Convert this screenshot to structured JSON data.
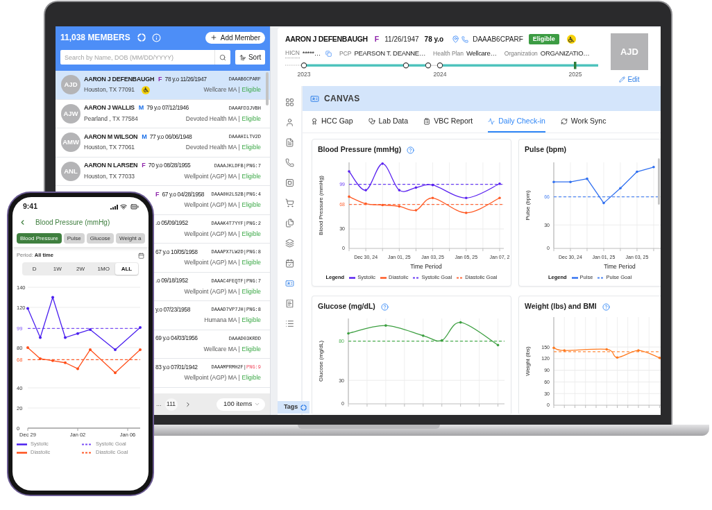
{
  "laptop": {
    "members_panel": {
      "title": "11,038 MEMBERS",
      "add_button": "Add Member",
      "search": {
        "placeholder": "Search by Name, DOB (MM/DD/YYYY)"
      },
      "sort_button": "Sort",
      "members": [
        {
          "initials": "AJD",
          "name": "AARON J DEFENBAUGH",
          "sex": {
            "text": "F",
            "color": "#8e24aa"
          },
          "age_dob": "78 y.o 11/26/1947",
          "member_id": "DAAAB6CPARF",
          "location": "Houston, TX 77091",
          "wheelchair": true,
          "plan": "Wellcare MA |",
          "status": "Eligible",
          "eligible": true,
          "selected": true
        },
        {
          "initials": "AJW",
          "name": "AARON J WALLIS",
          "sex": {
            "text": "M",
            "color": "#1a6fe8"
          },
          "age_dob": "79 y.o 07/12/1946",
          "member_id": "DAAAFD3JVBH",
          "location": "Pearland , TX 77584",
          "wheelchair": false,
          "plan": "Devoted Health MA |",
          "status": "Eligible",
          "eligible": true,
          "selected": false
        },
        {
          "initials": "AMW",
          "name": "AARON M WILSON",
          "sex": {
            "text": "M",
            "color": "#1a6fe8"
          },
          "age_dob": "77 y.o 06/06/1948",
          "member_id": "DAAAHILTV2D",
          "location": "Houston, TX 77061",
          "wheelchair": false,
          "plan": "Devoted Health MA |",
          "status": "Eligible",
          "eligible": true,
          "selected": false
        },
        {
          "initials": "ANL",
          "name": "AARON N LARSEN",
          "sex": {
            "text": "F",
            "color": "#8e24aa"
          },
          "age_dob": "70 y.o 08/28/1955",
          "member_id": "DAAAJKLDFB|",
          "png": {
            "text": "PNG:7",
            "alert": false
          },
          "location": "Houston, TX 77033",
          "wheelchair": false,
          "plan": "Wellpoint (AGP) MA |",
          "status": "Eligible",
          "eligible": true,
          "selected": false
        },
        {
          "sex": {
            "text": "F",
            "color": "#8e24aa"
          },
          "age_dob": "67 y.o 04/28/1958",
          "member_id": "DAAA0H2LS2B|",
          "png": {
            "text": "PNG:4",
            "alert": false
          },
          "wheelchair": false,
          "plan": "Wellpoint (AGP) MA |",
          "status": "Eligible",
          "eligible": true,
          "selected": false
        },
        {
          "age_dob": ".o 05/09/1952",
          "member_id": "DAAAK4T7YYF|",
          "png": {
            "text": "PNG:2",
            "alert": false
          },
          "wheelchair": false,
          "plan": "Wellpoint (AGP) MA |",
          "status": "Eligible",
          "eligible": true,
          "selected": false
        },
        {
          "age_dob": "67 y.o 10/05/1958",
          "member_id": "DAAAPX7LW2D|",
          "png": {
            "text": "PNG:8",
            "alert": false
          },
          "wheelchair": false,
          "plan": "Wellpoint (AGP) MA |",
          "status": "Eligible",
          "eligible": true,
          "selected": false
        },
        {
          "age_dob": ".o 09/18/1952",
          "member_id": "DAAAC4FEQTF|",
          "png": {
            "text": "PNG:7",
            "alert": false
          },
          "wheelchair": false,
          "plan": "Wellpoint (AGP) MA |",
          "status": "Eligible",
          "eligible": true,
          "selected": false
        },
        {
          "age_dob": "y.o 07/23/1958",
          "member_id": "DAAAD7VP7JH|",
          "png": {
            "text": "PNG:8",
            "alert": false
          },
          "wheelchair": false,
          "plan": "Humana MA |",
          "status": "Eligible",
          "eligible": true,
          "selected": false
        },
        {
          "age_dob": "69 y.o 04/03/1956",
          "member_id": "DAAAD03KRDD",
          "wheelchair": false,
          "plan": "Wellcare MA |",
          "status": "Eligible",
          "eligible": true,
          "selected": false
        },
        {
          "age_dob": "83 y.o 07/01/1942",
          "member_id": "DAAAMPRMH2F|",
          "png": {
            "text": "PNG:9",
            "alert": true
          },
          "wheelchair": false,
          "plan": "Wellpoint (AGP) MA |",
          "status": "Eligible",
          "eligible": true,
          "selected": false
        }
      ],
      "pagination": {
        "ellipsis": "...",
        "page": "111",
        "page_size": "100 items"
      }
    },
    "patient": {
      "name": "AARON J DEFENBAUGH",
      "sex": {
        "text": "F",
        "color": "#8e24aa"
      },
      "dob": "11/26/1947",
      "age": "78 y.o",
      "member_id": "DAAAB6CPARF",
      "badge": "Eligible",
      "wheelchair": true,
      "fields": [
        {
          "label": "HICN",
          "value": "*****…",
          "copyable": true
        },
        {
          "label": "PCP",
          "value": "PEARSON T. DEANNE…",
          "copyable": false
        },
        {
          "label": "Health Plan",
          "value": "Wellcare…",
          "copyable": false
        },
        {
          "label": "Organization",
          "value": "ORGANIZATIO…",
          "copyable": false
        }
      ],
      "timeline_years": [
        "2023",
        "2024",
        "2025"
      ],
      "initials": "AJD",
      "edit_link": "Edit"
    },
    "sidebar": {
      "items": [
        {
          "selected": false
        },
        {
          "selected": false
        },
        {
          "selected": false
        },
        {
          "selected": false
        },
        {
          "selected": false
        },
        {
          "selected": false
        },
        {
          "selected": false
        },
        {
          "selected": false
        },
        {
          "selected": false
        },
        {
          "selected": true
        },
        {
          "selected": false
        },
        {
          "selected": false
        }
      ],
      "tags_label": "Tags"
    },
    "canvas": {
      "title": "CANVAS",
      "tabs": [
        {
          "label": "HCC Gap",
          "selected": false
        },
        {
          "label": "Lab Data",
          "selected": false
        },
        {
          "label": "VBC Report",
          "selected": false
        },
        {
          "label": "Daily Check-in",
          "selected": true
        },
        {
          "label": "Work Sync",
          "selected": false
        }
      ],
      "cards": [
        {
          "help": true,
          "legend_title": "Legend",
          "chart_data": {
            "type": "line",
            "title": "Blood Pressure (mmHg)",
            "xlabel": "Time Period",
            "ylabel": "Blood Pressure (mmHg)",
            "categories": [
              null,
              "Dec 30, 24",
              null,
              "Jan 01, 25",
              null,
              "Jan 03, 25",
              null,
              "Jan 05, 25",
              null,
              "Jan 07, 2"
            ],
            "ylim": [
              0,
              133
            ],
            "yticks": [
              0,
              30,
              68,
              99
            ],
            "grid": "both",
            "legend": "bottom",
            "series": [
              {
                "name": "Systolic",
                "color": "#5a22f0",
                "values": [
                  119,
                  90,
                  131,
                  90,
                  94,
                  98,
                  null,
                  78,
                  null,
                  100
                ]
              },
              {
                "name": "Diastolic",
                "color": "#ff5a24",
                "values": [
                  80,
                  69,
                  67,
                  65,
                  59,
                  78,
                  null,
                  55,
                  null,
                  78
                ]
              }
            ],
            "ref_lines": [
              {
                "axis": "y",
                "value": 99,
                "label": "Systolic Goal",
                "color": "#6a3df5"
              },
              {
                "axis": "y",
                "value": 68,
                "label": "Diastolic Goal",
                "color": "#ff6b3d"
              }
            ]
          }
        },
        {
          "help": false,
          "legend_title": "Legend",
          "chart_data": {
            "type": "line",
            "title": "Pulse (bpm)",
            "xlabel": "Time Period",
            "ylabel": "Pulse (bpm)",
            "categories": [
              null,
              "Dec 30, 24",
              null,
              "Jan 01, 25",
              null,
              "Jan 03, 25",
              null
            ],
            "ylim": [
              0,
              110
            ],
            "yticks": [
              0,
              30,
              66
            ],
            "grid": "both",
            "legend": "bottom",
            "series": [
              {
                "name": "Pulse",
                "color": "#2f6ff0",
                "values": [
                  85,
                  85,
                  89,
                  58,
                  77,
                  98,
                  104
                ]
              }
            ],
            "ref_lines": [
              {
                "axis": "y",
                "value": 66,
                "label": "Pulse Goal",
                "color": "#4f86f2"
              }
            ]
          }
        },
        {
          "help": true,
          "chart_data": {
            "type": "line",
            "title": "Glucose (mg/dL)",
            "ylabel": "Glucose (mg/dL)",
            "categories": [
              null,
              null,
              null,
              null,
              null,
              null,
              null,
              null,
              null
            ],
            "ylim": [
              0,
              109
            ],
            "yticks": [
              0,
              30,
              80
            ],
            "grid": "both",
            "series": [
              {
                "color": "#3c9f40",
                "values": [
                  90,
                  null,
                  100,
                  null,
                  87,
                  81,
                  104,
                  null,
                  75
                ]
              }
            ],
            "ref_lines": [
              {
                "axis": "y",
                "value": 80,
                "color": "#4caf50"
              }
            ]
          }
        },
        {
          "help": true,
          "chart_data": {
            "type": "line",
            "title": "Weight (lbs) and BMI",
            "ylabel": "Weight (lbs)",
            "categories": [
              null,
              null,
              null,
              null,
              null,
              null,
              null,
              null,
              null,
              null,
              null
            ],
            "ylim": [
              0,
              227
            ],
            "yticks": [
              0,
              30,
              60,
              90,
              120,
              150
            ],
            "grid": "both",
            "series": [
              {
                "color": "#ff7a1f",
                "values": [
                  148,
                  141,
                  null,
                  null,
                  null,
                  144,
                  123,
                  null,
                  141,
                  null,
                  122
                ]
              }
            ],
            "ref_lines": [
              {
                "axis": "y",
                "value": 138,
                "color": "#ff8a3d"
              }
            ]
          }
        }
      ]
    }
  },
  "phone": {
    "status_time": "9:41",
    "title": "Blood Pressure (mmHg)",
    "chips": [
      {
        "label": "Blood Pressure",
        "selected": true
      },
      {
        "label": "Pulse",
        "selected": false
      },
      {
        "label": "Glucose",
        "selected": false
      },
      {
        "label": "Weight a",
        "selected": false
      }
    ],
    "period_label": "Period:",
    "period_value": "All time",
    "ranges": [
      {
        "label": "D",
        "selected": false
      },
      {
        "label": "1W",
        "selected": false
      },
      {
        "label": "2W",
        "selected": false
      },
      {
        "label": "1MO",
        "selected": false
      },
      {
        "label": "ALL",
        "selected": true
      }
    ],
    "chart_data": {
      "type": "line",
      "categories": [
        "Dec 29",
        null,
        null,
        null,
        "Jan 02",
        null,
        null,
        null,
        "Jan 06",
        null
      ],
      "ylim": [
        0,
        140
      ],
      "yticks": [
        0,
        20,
        40,
        68,
        80,
        99,
        120,
        140
      ],
      "grid": "y",
      "legend": "bottom",
      "series": [
        {
          "name": "Systolic",
          "color": "#4a1fef",
          "values": [
            119,
            90,
            130,
            90,
            94,
            98,
            null,
            78,
            null,
            100
          ]
        },
        {
          "name": "Diastolic",
          "color": "#ff4f1a",
          "values": [
            80,
            69,
            67,
            65,
            59,
            78,
            null,
            55,
            null,
            78
          ]
        }
      ],
      "ref_lines": [
        {
          "axis": "y",
          "value": 99,
          "label": "Systolic Goal",
          "color": "#7b4ff6"
        },
        {
          "axis": "y",
          "value": 68,
          "label": "Diastolic Goal",
          "color": "#ff5a2a"
        }
      ]
    }
  }
}
